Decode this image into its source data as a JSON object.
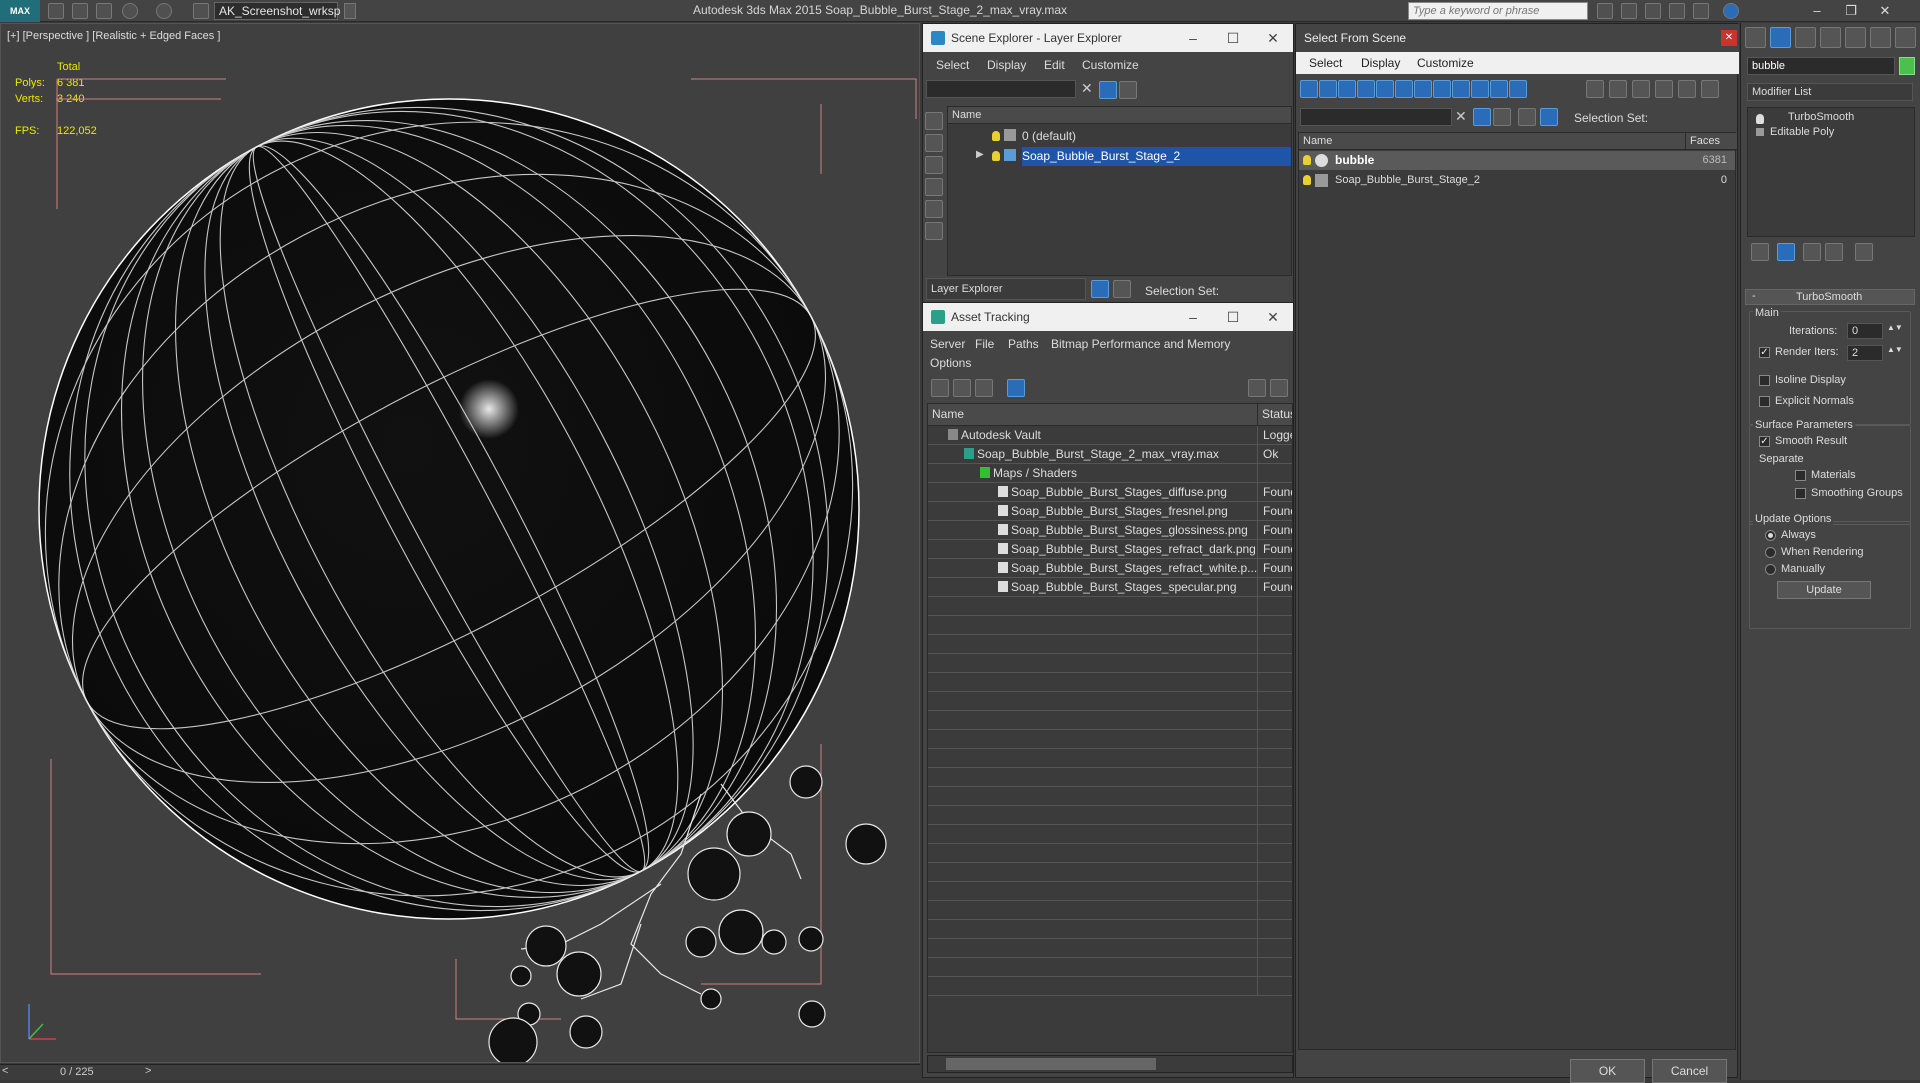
{
  "app": {
    "logo": "MAX",
    "workspace": "AK_Screenshot_wrksp",
    "title": "Autodesk 3ds Max  2015    Soap_Bubble_Burst_Stage_2_max_vray.max",
    "search_placeholder": "Type a keyword or phrase"
  },
  "viewport": {
    "label": "[+] [Perspective ] [Realistic + Edged Faces ]",
    "stats": {
      "total_label": "Total",
      "polys_label": "Polys:",
      "polys_value": "6 381",
      "verts_label": "Verts:",
      "verts_value": "3 240",
      "fps_label": "FPS:",
      "fps_value": "122,052"
    }
  },
  "timeline": {
    "frame": "0 / 225",
    "prev": "<",
    "next": ">"
  },
  "scene_explorer": {
    "title": "Scene Explorer - Layer Explorer",
    "menus": [
      "Select",
      "Display",
      "Edit",
      "Customize"
    ],
    "column": "Name",
    "rows": [
      "0 (default)",
      "Soap_Bubble_Burst_Stage_2"
    ],
    "footer_combo": "Layer Explorer",
    "selection_set": "Selection Set:"
  },
  "asset_tracking": {
    "title": "Asset Tracking",
    "menus": [
      "Server",
      "File",
      "Paths",
      "Bitmap Performance and Memory"
    ],
    "menus2": [
      "Options"
    ],
    "col_name": "Name",
    "col_status": "Status",
    "rows": [
      {
        "name": "Autodesk Vault",
        "status": "Logged"
      },
      {
        "name": "Soap_Bubble_Burst_Stage_2_max_vray.max",
        "status": "Ok"
      },
      {
        "name": "Maps / Shaders",
        "status": ""
      },
      {
        "name": "Soap_Bubble_Burst_Stages_diffuse.png",
        "status": "Found"
      },
      {
        "name": "Soap_Bubble_Burst_Stages_fresnel.png",
        "status": "Found"
      },
      {
        "name": "Soap_Bubble_Burst_Stages_glossiness.png",
        "status": "Found"
      },
      {
        "name": "Soap_Bubble_Burst_Stages_refract_dark.png",
        "status": "Found"
      },
      {
        "name": "Soap_Bubble_Burst_Stages_refract_white.p...",
        "status": "Found"
      },
      {
        "name": "Soap_Bubble_Burst_Stages_specular.png",
        "status": "Found"
      }
    ]
  },
  "select_from_scene": {
    "title": "Select From Scene",
    "menus": [
      "Select",
      "Display",
      "Customize"
    ],
    "selection_set": "Selection Set:",
    "col_name": "Name",
    "col_faces": "Faces",
    "rows": [
      {
        "name": "bubble",
        "faces": "6381"
      },
      {
        "name": "Soap_Bubble_Burst_Stage_2",
        "faces": "0"
      }
    ],
    "ok": "OK",
    "cancel": "Cancel"
  },
  "command_panel": {
    "object_name": "bubble",
    "modifier_list": "Modifier List",
    "stack": [
      "TurboSmooth",
      "Editable Poly"
    ],
    "rollout_title": "TurboSmooth",
    "main_group": "Main",
    "iterations_label": "Iterations:",
    "iterations_value": "0",
    "render_iters_label": "Render Iters:",
    "render_iters_value": "2",
    "isoline_label": "Isoline Display",
    "explicit_normals_label": "Explicit Normals",
    "surface_group": "Surface Parameters",
    "smooth_result_label": "Smooth Result",
    "separate_label": "Separate",
    "materials_label": "Materials",
    "smoothing_groups_label": "Smoothing Groups",
    "update_group": "Update Options",
    "always_label": "Always",
    "when_rendering_label": "When Rendering",
    "manually_label": "Manually",
    "update_button": "Update"
  }
}
